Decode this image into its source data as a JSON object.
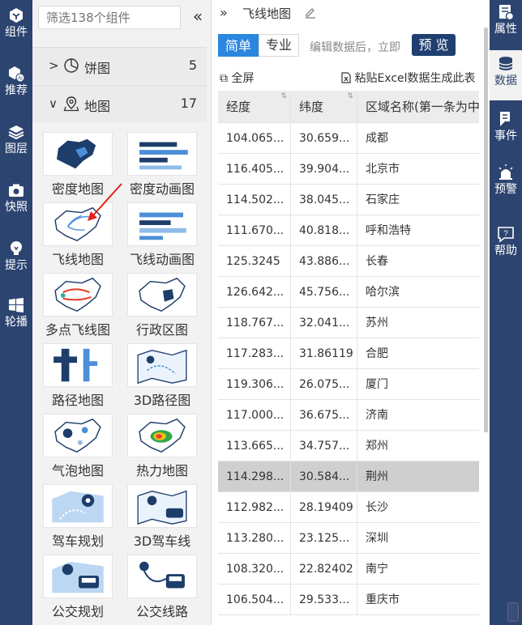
{
  "left_rail": [
    {
      "label": "组件",
      "icon": "component-icon"
    },
    {
      "label": "推荐",
      "icon": "ai-recommend-icon"
    },
    {
      "label": "图层",
      "icon": "layers-icon"
    },
    {
      "label": "快照",
      "icon": "camera-icon"
    },
    {
      "label": "提示",
      "icon": "lightbulb-icon"
    },
    {
      "label": "轮播",
      "icon": "windows-icon"
    }
  ],
  "component_panel": {
    "search_placeholder": "筛选138个组件",
    "collapse_label": "«",
    "categories": [
      {
        "chevron": ">",
        "label": "饼图",
        "count": "5",
        "icon": "pie-icon"
      },
      {
        "chevron": "∨",
        "label": "地图",
        "count": "17",
        "icon": "map-pin-icon"
      }
    ],
    "tiles": [
      {
        "label": "密度地图",
        "icon": "density-map-icon"
      },
      {
        "label": "密度动画图",
        "icon": "density-animation-icon"
      },
      {
        "label": "飞线地图",
        "icon": "flyline-map-icon"
      },
      {
        "label": "飞线动画图",
        "icon": "flyline-animation-icon"
      },
      {
        "label": "多点飞线图",
        "icon": "multipoint-flyline-icon"
      },
      {
        "label": "行政区图",
        "icon": "admin-region-icon"
      },
      {
        "label": "路径地图",
        "icon": "route-map-icon"
      },
      {
        "label": "3D路径图",
        "icon": "route-3d-icon"
      },
      {
        "label": "气泡地图",
        "icon": "bubble-map-icon"
      },
      {
        "label": "热力地图",
        "icon": "heat-map-icon"
      },
      {
        "label": "驾车规划",
        "icon": "drive-plan-icon"
      },
      {
        "label": "3D驾车线",
        "icon": "drive-3d-icon"
      },
      {
        "label": "公交规划",
        "icon": "bus-plan-icon"
      },
      {
        "label": "公交线路",
        "icon": "bus-route-icon"
      }
    ]
  },
  "main": {
    "breadcrumb_expand": "»",
    "title": "飞线地图",
    "mode_simple": "简单",
    "mode_pro": "专业",
    "edit_hint": "编辑数据后，立即",
    "preview": "预 览",
    "fullscreen": "全屏",
    "paste_excel": "粘贴Excel数据生成此表",
    "table": {
      "headers": [
        "经度",
        "纬度",
        "区域名称(第一条为中."
      ],
      "rows": [
        [
          "104.065...",
          "30.659...",
          "成都"
        ],
        [
          "116.405...",
          "39.904...",
          "北京市"
        ],
        [
          "114.502...",
          "38.045...",
          "石家庄"
        ],
        [
          "111.670...",
          "40.818...",
          "呼和浩特"
        ],
        [
          "125.3245",
          "43.886...",
          "长春"
        ],
        [
          "126.642...",
          "45.756...",
          "哈尔滨"
        ],
        [
          "118.767...",
          "32.041...",
          "苏州"
        ],
        [
          "117.283...",
          "31.86119",
          "合肥"
        ],
        [
          "119.306...",
          "26.075...",
          "厦门"
        ],
        [
          "117.000...",
          "36.675...",
          "济南"
        ],
        [
          "113.665...",
          "34.757...",
          "郑州"
        ],
        [
          "114.298...",
          "30.584...",
          "荆州"
        ],
        [
          "112.982...",
          "28.19409",
          "长沙"
        ],
        [
          "113.280...",
          "23.125...",
          "深圳"
        ],
        [
          "108.320...",
          "22.82402",
          "南宁"
        ],
        [
          "106.504...",
          "29.533...",
          "重庆市"
        ]
      ],
      "selected_row": 11
    }
  },
  "right_rail": [
    {
      "label": "属性",
      "icon": "properties-icon"
    },
    {
      "label": "数据",
      "icon": "database-icon",
      "active": true
    },
    {
      "label": "事件",
      "icon": "event-icon"
    },
    {
      "label": "预警",
      "icon": "alarm-icon"
    },
    {
      "label": "帮助",
      "icon": "help-icon"
    }
  ]
}
